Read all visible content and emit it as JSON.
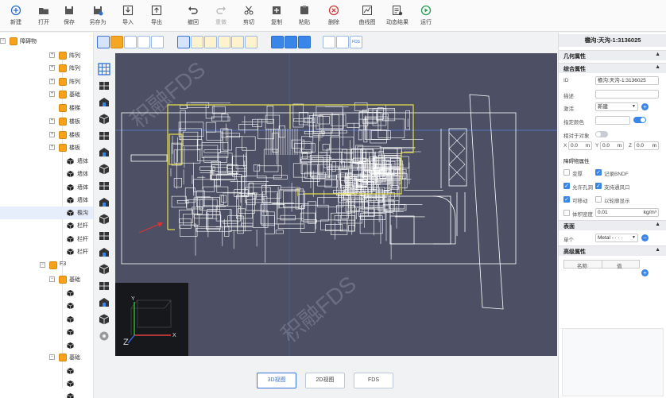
{
  "toolbar": [
    {
      "name": "new",
      "label": "新建",
      "icon": "plus-circle-icon",
      "disabled": false
    },
    {
      "name": "open",
      "label": "打开",
      "icon": "folder-icon",
      "disabled": false
    },
    {
      "name": "save",
      "label": "保存",
      "icon": "save-icon",
      "disabled": false
    },
    {
      "name": "save-as",
      "label": "另存为",
      "icon": "save-as-icon",
      "disabled": false
    },
    {
      "name": "import",
      "label": "导入",
      "icon": "import-icon",
      "disabled": false
    },
    {
      "name": "export",
      "label": "导出",
      "icon": "export-icon",
      "disabled": false
    },
    {
      "name": "undo",
      "label": "撤回",
      "icon": "undo-icon",
      "disabled": false
    },
    {
      "name": "redo",
      "label": "重做",
      "icon": "redo-icon",
      "disabled": true
    },
    {
      "name": "cut",
      "label": "剪切",
      "icon": "scissors-icon",
      "disabled": false
    },
    {
      "name": "copy",
      "label": "复制",
      "icon": "copy-icon",
      "disabled": false
    },
    {
      "name": "paste",
      "label": "粘贴",
      "icon": "paste-icon",
      "disabled": false
    },
    {
      "name": "delete",
      "label": "删除",
      "icon": "delete-icon",
      "disabled": false
    },
    {
      "name": "curve",
      "label": "曲线图",
      "icon": "line-chart-icon",
      "disabled": false
    },
    {
      "name": "anim",
      "label": "动态结果",
      "icon": "animation-icon",
      "disabled": false
    },
    {
      "name": "run",
      "label": "运行",
      "icon": "play-icon",
      "disabled": false
    }
  ],
  "tree": [
    {
      "label": "障碍物",
      "kind": "folder",
      "toggle": "−",
      "sel": false
    },
    {
      "label": "阵列",
      "kind": "folder",
      "toggle": "+",
      "sel": false
    },
    {
      "label": "阵列",
      "kind": "folder",
      "toggle": "+",
      "sel": false
    },
    {
      "label": "阵列",
      "kind": "folder",
      "toggle": "+",
      "sel": false
    },
    {
      "label": "基础",
      "kind": "folder",
      "toggle": "+",
      "sel": false
    },
    {
      "label": "楼梯",
      "kind": "folder",
      "toggle": "",
      "sel": false
    },
    {
      "label": "楼板",
      "kind": "folder",
      "toggle": "+",
      "sel": false
    },
    {
      "label": "楼板",
      "kind": "folder",
      "toggle": "+",
      "sel": false
    },
    {
      "label": "楼板",
      "kind": "folder",
      "toggle": "+",
      "sel": false
    },
    {
      "label": "墙体",
      "kind": "block",
      "toggle": "",
      "sel": false
    },
    {
      "label": "墙体",
      "kind": "block",
      "toggle": "",
      "sel": false
    },
    {
      "label": "墙体",
      "kind": "block",
      "toggle": "",
      "sel": false
    },
    {
      "label": "墙体",
      "kind": "block",
      "toggle": "",
      "sel": false
    },
    {
      "label": "檐沟",
      "kind": "block",
      "toggle": "",
      "sel": true
    },
    {
      "label": "栏杆",
      "kind": "block",
      "toggle": "",
      "sel": false
    },
    {
      "label": "栏杆",
      "kind": "block",
      "toggle": "",
      "sel": false
    },
    {
      "label": "栏杆",
      "kind": "block",
      "toggle": "",
      "sel": false
    },
    {
      "label": "F3",
      "kind": "folder",
      "toggle": "−",
      "sel": false
    },
    {
      "label": "基础",
      "kind": "folder",
      "toggle": "−",
      "sel": false
    },
    {
      "label": "",
      "kind": "block",
      "toggle": "",
      "sel": false
    },
    {
      "label": "",
      "kind": "block",
      "toggle": "",
      "sel": false
    },
    {
      "label": "",
      "kind": "block",
      "toggle": "",
      "sel": false
    },
    {
      "label": "",
      "kind": "block",
      "toggle": "",
      "sel": false
    },
    {
      "label": "",
      "kind": "block",
      "toggle": "",
      "sel": false
    },
    {
      "label": "基础",
      "kind": "folder",
      "toggle": "−",
      "sel": false
    },
    {
      "label": "",
      "kind": "block",
      "toggle": "",
      "sel": false
    },
    {
      "label": "",
      "kind": "block",
      "toggle": "",
      "sel": false
    },
    {
      "label": "",
      "kind": "block",
      "toggle": "",
      "sel": false
    },
    {
      "label": "",
      "kind": "block",
      "toggle": "",
      "sel": false
    }
  ],
  "view_tabs": [
    {
      "label": "3D视图",
      "active": true
    },
    {
      "label": "2D视图",
      "active": false
    },
    {
      "label": "FDS",
      "active": false
    }
  ],
  "viewport": {
    "axis": {
      "x": "X",
      "y": "Y",
      "z": "Z"
    },
    "watermark": "积融FDS",
    "colors": {
      "background": "#4d5065",
      "wire": "#ffffff",
      "highlight": "#e6e04a",
      "arrow": "#e03030"
    }
  },
  "props": {
    "title": "檐沟:天沟-1:3136025",
    "sections": {
      "geometry": "几何属性",
      "general": "综合属性",
      "obstruction": "障碍物属性",
      "surface": "表面",
      "advanced": "高级属性"
    },
    "fields": {
      "id_label": "ID",
      "id_value": "檐沟:天沟-1:3136025",
      "desc_label": "描述",
      "desc_value": "",
      "activate_label": "激活",
      "activate_value": "新建",
      "color_label": "指定颜色",
      "relative_label": "相对于对象",
      "x_label": "X",
      "x_value": "0.0",
      "x_unit": "m",
      "y_label": "Y",
      "y_value": "0.0",
      "y_unit": "m",
      "z_label": "Z",
      "z_value": "0.0",
      "z_unit": "m"
    },
    "obstruction": {
      "thicken": "变厚",
      "record_bndf": "记录BNDF",
      "allow_hole": "允许孔洞",
      "support_vent": "支持通风口",
      "movable": "可移动",
      "outline": "以轮廓显示",
      "bulk_density_label": "体积密度",
      "bulk_density_value": "0.01",
      "bulk_density_unit": "kg/m³"
    },
    "surface": {
      "label": "单个",
      "value": "Metal - · · ·"
    },
    "advanced": {
      "col_name": "名称",
      "col_value": "值"
    }
  }
}
